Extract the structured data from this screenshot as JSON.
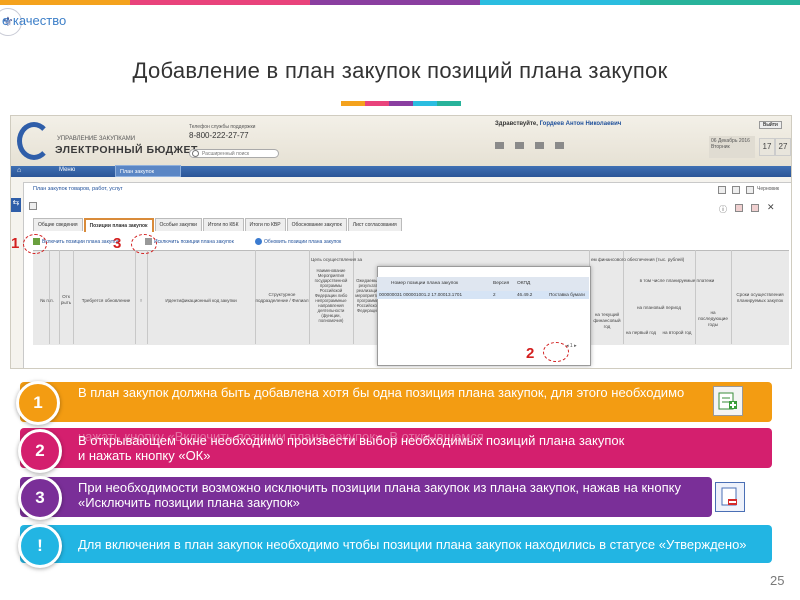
{
  "header": {
    "brand": "е качество",
    "title": "Добавление в план закупок позиций плана закупок",
    "top_strip_colors": [
      "#f4a21d",
      "#e9437b",
      "#8a3ea0",
      "#2bbde0",
      "#28b39b",
      "#f4a21d"
    ],
    "underline_colors": [
      "#f4a21d",
      "#e9437b",
      "#8a3ea0",
      "#2bbde0",
      "#28b39b"
    ]
  },
  "screenshot": {
    "logo_small": "УПРАВЛЕНИЕ ЗАКУПКАМИ",
    "logo_big": "ЭЛЕКТРОННЫЙ БЮДЖЕТ",
    "phone_label": "Телефон службы поддержки",
    "phone": "8-800-222-27-77",
    "search_placeholder": "Расширенный поиск",
    "greeting": "Здравствуйте,",
    "user": "Гордеев Антон Николаевич",
    "exit": "Выйти",
    "date": "06 Декабрь 2016",
    "weekday": "Вторник",
    "day_a": "17",
    "day_b": "27",
    "nav_menu": "Меню",
    "nav_tab": "План закупок",
    "doc_title": "План закупок товаров, работ, услуг",
    "draft": "Черновик",
    "tabs": [
      "Общие сведения",
      "Позиции плана закупок",
      "Особые закупки",
      "Итоги по КБК",
      "Итоги по КВР",
      "Обоснование закупок",
      "Лист согласования"
    ],
    "toolbar": {
      "add": "Включить позиции плана закупок",
      "exclude": "Исключить позиции плана закупок",
      "refresh": "Обновить позиции плана закупок"
    },
    "grid_headers": {
      "num": "№ п.п.",
      "flag": "Отк рыть",
      "need": "Требуется обновление",
      "excl": "!",
      "ikz": "Идентификационный код закупки",
      "dept": "Структурное подразделение / Филиал",
      "goal": "Цель осуществления за",
      "event": "Наименование Мероприятия государственной программы Российской Федерации либо непрограммные направления деятельности (функции, полномочия)",
      "expected": "Ожидаемый результат реализации мероприятия программы Российской Федерации",
      "finance": "ем финансового обеспечения (тыс. рублей)",
      "incl": "в том числе планируемые платежи",
      "cur": "на текущий финансовый год",
      "plan": "на плановый период",
      "y1": "на первый год",
      "y2": "на второй год",
      "later": "на последующие годы",
      "dates": "Сроки осуществления планируемых закупок"
    },
    "popup": {
      "col1": "Номер позиции плана закупок",
      "col2": "Версия",
      "col3": "ОКПД",
      "row_number": "000000031 000001001.2 17.00013.1701",
      "row_version": "2",
      "row_okpd": "46.49.2",
      "row_desc": "Поставка бумаги"
    },
    "markers": [
      "1",
      "2",
      "3"
    ]
  },
  "steps": [
    {
      "num": "1",
      "color": "#f39c12",
      "text": "В план закупок должна быть добавлена хотя бы одна позиция плана закупок, для этого необходимо"
    },
    {
      "num": "2",
      "color": "#d41f6e",
      "text_over": "нажать кнопку «Включить позиции плана закупок». В открывшемся",
      "text_a": "В открывающем окне необходимо произвести выбор необходимых позиций плана закупок",
      "text_b": "и нажать кнопку «ОК»"
    },
    {
      "num": "3",
      "color": "#7a2f98",
      "text": "При необходимости возможно исключить позиции плана закупок из плана закупок, нажав на кнопку «Исключить позиции плана закупок»"
    },
    {
      "num": "!",
      "color": "#22b5e3",
      "text": "Для включения в план закупок необходимо чтобы позиции плана закупок находились в статусе «Утверждено»"
    }
  ],
  "page_number": "25"
}
